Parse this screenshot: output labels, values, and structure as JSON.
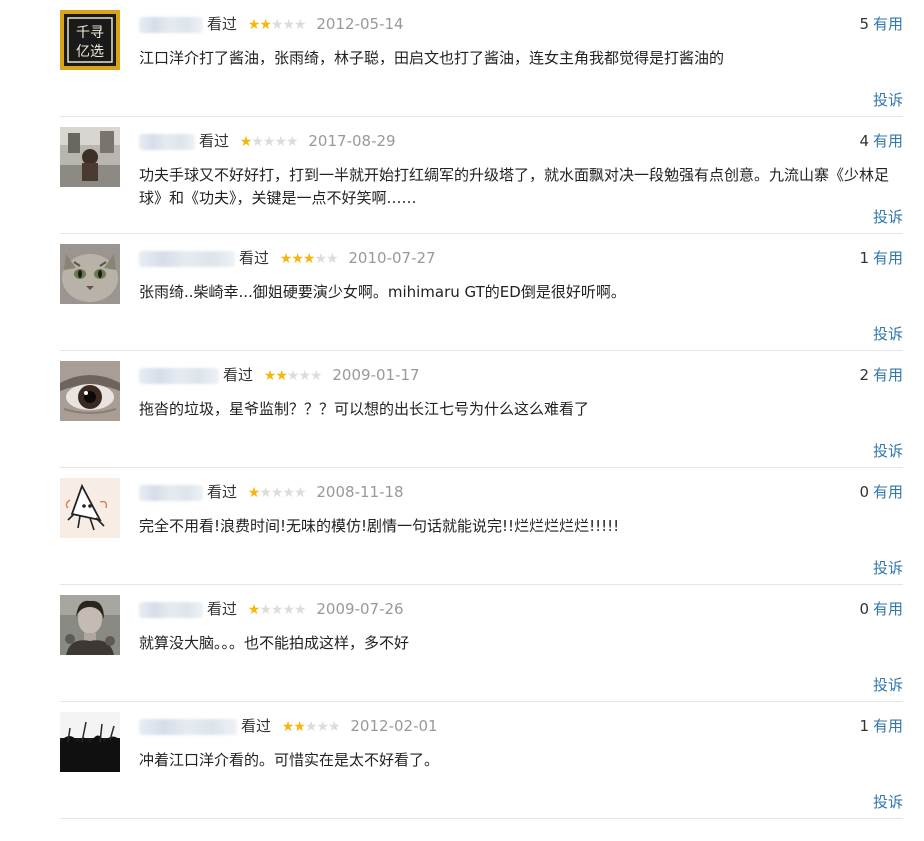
{
  "reviews": [
    {
      "status": "看过",
      "stars": 2,
      "date": "2012-05-14",
      "useful_count": "5",
      "useful_label": "有用",
      "content": "江口洋介打了酱油，张雨绮，林子聪，田启文也打了酱油，连女主角我都觉得是打酱油的",
      "report": "投诉",
      "avatar_text_1": "千寻",
      "avatar_text_2": "亿选"
    },
    {
      "status": "看过",
      "stars": 1,
      "date": "2017-08-29",
      "useful_count": "4",
      "useful_label": "有用",
      "content": "功夫手球又不好好打，打到一半就开始打红绸军的升级塔了，就水面飘对决一段勉强有点创意。九流山寨《少林足球》和《功夫》，关键是一点不好笑啊……",
      "report": "投诉"
    },
    {
      "status": "看过",
      "stars": 3,
      "date": "2010-07-27",
      "useful_count": "1",
      "useful_label": "有用",
      "content": "张雨绮..柴崎幸...御姐硬要演少女啊。mihimaru GT的ED倒是很好听啊。",
      "report": "投诉"
    },
    {
      "status": "看过",
      "stars": 2,
      "date": "2009-01-17",
      "useful_count": "2",
      "useful_label": "有用",
      "content": "拖沓的垃圾，星爷监制？？？可以想的出长江七号为什么这么难看了",
      "report": "投诉"
    },
    {
      "status": "看过",
      "stars": 1,
      "date": "2008-11-18",
      "useful_count": "0",
      "useful_label": "有用",
      "content": "完全不用看!浪费时间!无味的模仿!剧情一句话就能说完!!烂烂烂烂烂!!!!!",
      "report": "投诉"
    },
    {
      "status": "看过",
      "stars": 1,
      "date": "2009-07-26",
      "useful_count": "0",
      "useful_label": "有用",
      "content": "就算没大脑。。。也不能拍成这样，多不好",
      "report": "投诉"
    },
    {
      "status": "看过",
      "stars": 2,
      "date": "2012-02-01",
      "useful_count": "1",
      "useful_label": "有用",
      "content": "冲着江口洋介看的。可惜实在是太不好看了。",
      "report": "投诉"
    }
  ],
  "colors": {
    "link": "#3377aa",
    "star_on": "#f4b70a",
    "star_off": "#dcdcdc",
    "date": "#999999"
  }
}
